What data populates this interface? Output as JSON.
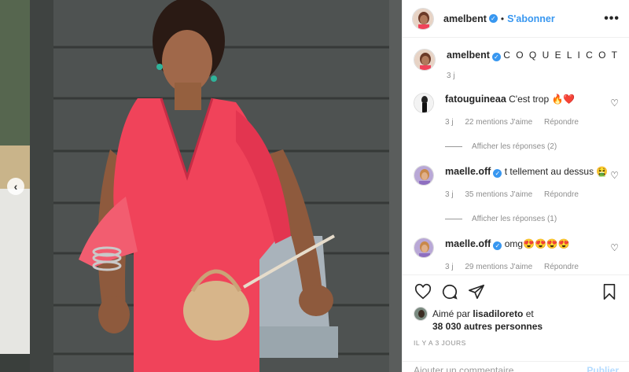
{
  "post": {
    "author": "amelbent",
    "follow_label": "S'abonner",
    "more_label": "•••",
    "caption_text": "C O Q U E L I C O T",
    "caption_time": "3 j"
  },
  "comments": [
    {
      "user": "fatouguineaa",
      "verified": false,
      "text": "C'est trop 🔥❤️",
      "time": "3 j",
      "likes": "22 mentions J'aime",
      "reply": "Répondre",
      "view_replies": "Afficher les réponses (2)"
    },
    {
      "user": "maelle.off",
      "verified": true,
      "text": "t tellement au dessus 🤮",
      "time": "3 j",
      "likes": "35 mentions J'aime",
      "reply": "Répondre",
      "view_replies": "Afficher les réponses (1)"
    },
    {
      "user": "maelle.off",
      "verified": true,
      "text": "omg😍😍😍😍",
      "time": "3 j",
      "likes": "29 mentions J'aime",
      "reply": "Répondre"
    }
  ],
  "likes_section": {
    "prefix": "Aimé par",
    "liked_by": "lisadiloreto",
    "conj": "et",
    "others": "38 030 autres personnes",
    "date": "IL Y A 3 JOURS"
  },
  "composer": {
    "placeholder": "Ajouter un commentaire...",
    "publish_label": "Publier"
  },
  "colors": {
    "accent": "#3897f0",
    "dress": "#f0435a",
    "wall": "#4a4d4d"
  }
}
